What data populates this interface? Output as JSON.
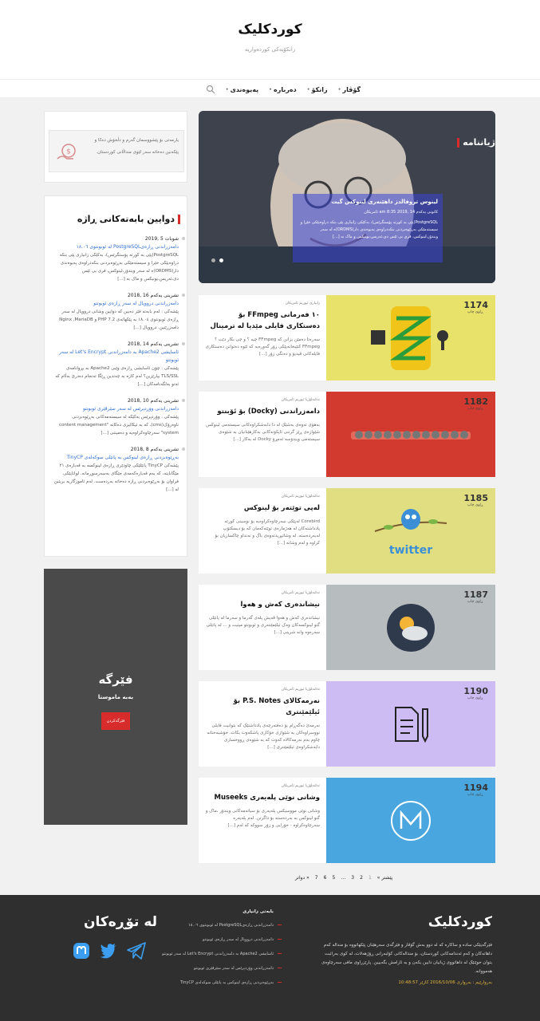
{
  "site": {
    "title": "کوردکلیک",
    "tagline": "زانکۆیەکی کوردەواریە"
  },
  "nav": {
    "items": [
      "گۆڤار",
      "زانکۆ",
      "دەربارە",
      "پەیوەندی"
    ]
  },
  "ad": {
    "text": "یارمەتی بۆ پێشووسمان گەرم و دڵخۆش دەکا و پێکەنین دەخاتە سەر لێوی منداڵانی کوردستان."
  },
  "recent": {
    "title": "دوایین بابەتەکانی ڕاژە",
    "items": [
      {
        "date": "شوبات 5 ,2019",
        "title": "دامەزراندنی ڕازەیPostgreSQL لە ئوبونتوی ١٨.٠٦",
        "excerpt": "PostgreSQL(پێی بە کورتە پۆستگرێس)، بەکێکی زانیاری پێی بنکە دراوەیێکی خێرا و سیستەمێکی بەڕێوەبردنی بنکەدراوەی پەیوەندی دار(ORDMS)ە لە سەر ویندۆز،لینوکس، فری بی ئێس دی،ئەریس،یونیکس و ماک بە [...]"
      },
      {
        "date": "تشرینی یەکەم 16 ,2018",
        "title": "دامەزراندنی درووپال لە سەر ڕازەی ئوبونتو",
        "excerpt": "پێشەکی : لەم بابەتە فێر دەبین کە دوایین وشانی درووپال لە سەر ڕازەی ئوبونتوی ١٨.٠٤ بە پێکهاتەی PHP 7.2 و Nginx ,MariaDB دامەزرێنین. درووپال [...]"
      },
      {
        "date": "تشرینی یەکەم 14 ,2018",
        "title": "ئاسایشی Apache2 بە دامەزراندنی Let's Encrypt لە سەر ئوبونتو",
        "excerpt": "پێشەکی : چۆن ئاسایشی ڕازەی وێبی Apache2 بە بڕوانامەی TLS/SSL بپارێزین؟ لەم کارە بە چەندین ڕێگا ئەنجام دەدرێ بەڵام کە ئەتو بەلگەنامەکان [...]"
      },
      {
        "date": "تشرینی یەکەم 10 ,2018",
        "title": "دامەزراندنی وۆردپرێس لە سەر سێرڤێری ئوبونتو",
        "excerpt": "پێشەکی : وۆردپرێس بەکێکە لە سیستەمەکانی بەڕێوەبردنی ناوەرۆک(cms)، کە بە ئیکالیزی دەکاتە \"content management system\" سەرچاوەکراوەیە و دەمیننی [...]"
      },
      {
        "date": "تشرینی یەکەم 8 ,2018",
        "title": "بەڕێوەبردنی ڕازەی لینوکس بە پانێلی سوکەلەی TinyCP",
        "excerpt": "پێشەکی TinyCP پانێلێکی چاودێری ڕازەی لینوکسە بە قەبارەی ۲۱ مێگابایتە، کە بەم قەبارەکەمەی جێگای بەسەرسوڕمانە. لوانایێکی فراوان بۆ بەڕێوەبردنی ڕازە دەخاتە بەردەست. لەم ئاموزگاریە بریتین لە [...]"
      }
    ]
  },
  "promo": {
    "title": "فێرگە",
    "subtitle": "بەبە ماموستا",
    "button": "فێرگەکردن"
  },
  "slider": {
    "label": "ژیاننامە",
    "card_title": "لینوس تروفالدز داهێنەری لینوکس گیت",
    "card_meta": "کانونی یەکەم 14 ,2019 am 8:35 ئامریکان",
    "card_excerpt": "PostgreSQL(پێی بە کورتە پۆستگرێس)، بەکێکی زانیاری پێی بنکە دراوەیێکی خێرا و سیستەمێکی بەڕێوەبردنی بنکەدراوەی پەیوەندی دار(ORDMS)ە لە سەر ویندۆز،لینوکس، فری بی ئێس دی،ئەریس،یونیکس و ماک بە [...]"
  },
  "posts": [
    {
      "count": "1174",
      "count_label": "ڕاوی چاپ",
      "meta": "زانیاری   ئیوریم   ئامریکان",
      "title": "١٠ فەرمانی FFmpeg بۆ دەستکاری فایلی مێدیا لە ترمینال",
      "excerpt": "سەرەتا دەمێن بزانن کە FFmpeg چیە ؟ و چی بکار دێت ؟ FFmpeg کتێبخانەیێکی زۆر گەورەیە کە ئێوە دەتوانن دەستکاری فایلەکانی ڤیدیۆ و دەنگی زۆر [...]",
      "color": "#e8e16a",
      "icon": "ffmpeg-icon"
    },
    {
      "count": "1182",
      "count_label": "ڕاوی چاپ",
      "meta": "تەکنەلۆژیا   ئیوریم   ئامریکان",
      "title": "دامەزراندنی (Docky) بۆ ئۆبنتو",
      "excerpt": "بەهۆی ئەوەی بەشێک لە دا دابەشکراوەکانی سیستەمی لینوکس شێوازەی ڕێز گرتنی ئاپکۆنەکانی بەکارهێنانیان بە شێوەی سیستەمی ویندۆسە ئەمڕۆ Docky لە بەکار [...]",
      "color": "#d23a2f",
      "icon": "docky-icon"
    },
    {
      "count": "1185",
      "count_label": "ڕاوی چاپ",
      "meta": "تەکنەلۆژیا   ئیوریم   ئامریکان",
      "title": "لەپی توێتەر بۆ لینوکس",
      "excerpt": "Corebird لەپێکی سەرچاوەکراوەیە بۆ نوسینی کورتە پادداشتەکان لە هەژمارەی توێتەکەمان کە بۆ دیسکتۆپ لەبەردەستە. لە وشاتیڕیدتەوەی باگ و تەنداو چاکسازیان بۆ کراوە و لەم وشانە [...]",
      "color": "#e0de80",
      "icon": "twitter-bird-icon"
    },
    {
      "count": "1187",
      "count_label": "ڕاوی چاپ",
      "meta": "تەکنەلۆژیا   ئیوریم   ئامریکان",
      "title": "نیشاندەری کەش و هەوا",
      "excerpt": "نیشاندەری کەش و هەوا ڤەیش پلەی گەرما و سەرما لە پانێلی گنو لینوکسەکان وەک ئیلێمێنتەری و ئوبونتو مینیت و ... لە پانێلی سەرەوە وانه شرینی [...]",
      "color": "#b7bdbf",
      "icon": "weather-icon"
    },
    {
      "count": "1190",
      "count_label": "ڕاوی چاپ",
      "meta": "تەکنەلۆژیا   ئیوریم   ئامریکان",
      "title": "نەرمەکالای P.S. Notes بۆ ئیلێمێنتری",
      "excerpt": "نەرمەئ دەگەڕام بۆ دەفتەرچەی یادداشتێک کە بتوانیت فایلی نووسراوەکان بە شێوازی خۆکاری پاشکەوت بکات. خۆشبەختانە چاوم بەم نەرمەکالاە کەوت کە بە شێوەی ڕووخساری دابەشکراوەی ئیلێمێنتری [...]",
      "color": "#cdbbf3",
      "icon": "notes-icon"
    },
    {
      "count": "1194",
      "count_label": "ڕاوی چاپ",
      "meta": "تەکنەلۆژیا   ئیوریم   ئامریکان",
      "title": "وشانی نوێی پلەیەری Museeks",
      "excerpt": "وشانی نوێی مووسیکس پلەیەری بۆ سیاتەمەکانی ویندۆز ،ماک و گنو لینوکس بە بەردەستە بۆ داگرتن. لەم پلەیەرە سەرچاوەکراوە - خۆرایی و زۆر سووکە کە لەم [...]",
      "color": "#4aa6df",
      "icon": "museeks-icon"
    }
  ],
  "pager": {
    "prev": "« پێشتر",
    "pages": [
      "1",
      "2",
      "3",
      "…",
      "5",
      "6",
      "7"
    ],
    "next": "دواتر »"
  },
  "footer": {
    "title": "کوردکلیک",
    "text": "فێرگەیێکی سادە و ساکارە کە لە دوو بەش گۆڤار و فێرگەی سەرهێنان پێکهاتووە بۆ مندالە کەم داهاتەکان و کەم ئەندامەکانی کوردستان، بۆ مندالەکانی کۆلبەرانی ڕۆژهەلات، لە کوی بەرائبت بتوان خوێنێک لە داهاتووی ژیانیان دابین بکەن و بە ئارامش بگەییبن. پارێزراوی مافی سەرچاوەی هەمووانە.",
    "date_label": "بەروارێیم :",
    "date_value": "بەرواری 2016/10/06 کازێر 10:48:57",
    "col_head": "بابەتی زانیاری",
    "links": [
      "دامەزراندنی ڕازەیPostgreSQL لە ئوبونتوی ١٨.٠٦",
      "دامەزراندنی درووپال لە سەر ڕازەی ئوبونتو",
      "ئاسایشی Apache2 بە دامەزراندنی Let's Encrypt لە سەر ئوبونتو",
      "دامەزراندنی وۆردپرێس لە سەر سێرڤێری ئوبونتو",
      "بەڕێوەبردنی ڕازەی لینوکس بە پانێلی سوکەلەی TinyCP"
    ],
    "follow_title": "لە تۆڕەکان"
  }
}
